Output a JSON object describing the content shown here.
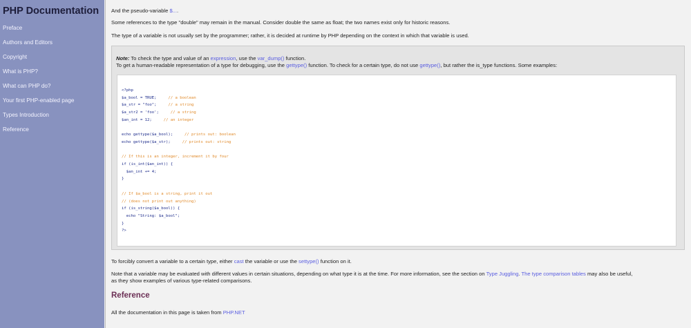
{
  "sidebar": {
    "title": "PHP Documentation",
    "items": [
      {
        "label": "Preface"
      },
      {
        "label": "Authors and Editors"
      },
      {
        "label": "Copyright"
      },
      {
        "label": "What is PHP?"
      },
      {
        "label": "What can PHP do?"
      },
      {
        "label": "Your first PHP-enabled page"
      },
      {
        "label": "Types Introduction"
      },
      {
        "label": "Reference"
      }
    ]
  },
  "content": {
    "pseudo_text": "And the pseudo-variable",
    "pseudo_link": "$...",
    "pseudo_end": ".",
    "double_text": "Some references to the type \"double\" may remain in the manual. Consider double the same as float; the two names exist only for historic reasons.",
    "type_text": "The type of a variable is not usually set by the programmer; rather, it is decided at runtime by PHP depending on the context in which that variable is used.",
    "note": {
      "label": "Note:",
      "line1_a": "To check the type and value of an",
      "expression_link": "expression",
      "line1_b": ", use the",
      "var_dump_link": "var_dump()",
      "line1_c": "function.",
      "line2_a": "To get a human-readable representation of a type for debugging, use the",
      "gettype_link": "gettype()",
      "line2_b": "function. To check for a certain type, do not use",
      "gettype_link2": "gettype()",
      "line2_c": ", but rather the is_type functions. Some examples:"
    },
    "code": {
      "l01": "<?php",
      "l02": "$a_bool = TRUE;",
      "l02c": "// a boolean",
      "l03": "$a_str = \"foo\";",
      "l03c": "// a string",
      "l04": "$a_str2 = 'foo';",
      "l04c": "// a string",
      "l05": "$an_int = 12;",
      "l05c": "// an integer",
      "l06": "echo gettype($a_bool);",
      "l06c": "// prints out: boolean",
      "l07": "echo gettype($a_str);",
      "l07c": "// prints out: string",
      "l08c": "// If this is an integer, increment it by four",
      "l09": "if (is_int($an_int)) {",
      "l10": "  $an_int += 4;",
      "l11": "}",
      "l12c": "// If $a_bool is a string, print it out",
      "l13c": "// (does not print out anything)",
      "l14": "if (is_string($a_bool)) {",
      "l15": "  echo \"String: $a_bool\";",
      "l16": "}",
      "l17": "?>"
    },
    "convert_a": "To forcibly convert a variable to a certain type, either",
    "cast_link": "cast",
    "convert_b": "the variable or use the",
    "settype_link": "settype()",
    "convert_c": "function on it.",
    "eval_a": "Note that a variable may be evaluated with different values in certain situations, depending on what type it is at the time. For more information, see the section on",
    "juggling_link": "Type Juggling",
    "eval_b": ". ",
    "comparison_link": "The type comparison tables",
    "eval_c": "may also be useful,",
    "eval_d": "as they show examples of various type-related comparisons.",
    "reference_heading": "Reference",
    "taken_a": "All the documentation in this page is taken from",
    "phpnet_link": "PHP.NET"
  },
  "colors": {
    "sidebar_bg": "#8892bf",
    "link": "#5a5ee0",
    "heading": "#6b2f55",
    "comment": "#e08a2a"
  }
}
